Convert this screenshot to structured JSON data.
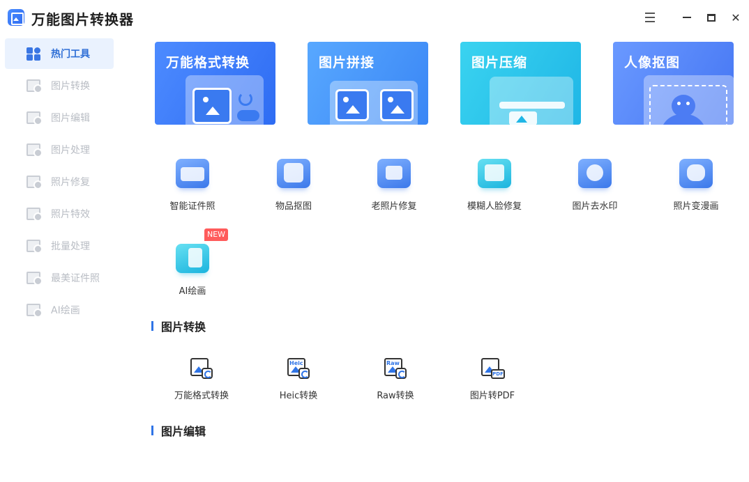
{
  "app": {
    "title": "万能图片转换器"
  },
  "sidebar": {
    "items": [
      {
        "label": "热门工具",
        "active": true
      },
      {
        "label": "图片转换"
      },
      {
        "label": "图片编辑"
      },
      {
        "label": "图片处理"
      },
      {
        "label": "照片修复"
      },
      {
        "label": "照片特效"
      },
      {
        "label": "批量处理"
      },
      {
        "label": "最美证件照"
      },
      {
        "label": "AI绘画"
      }
    ]
  },
  "banners": [
    {
      "title": "万能格式转换",
      "icon": "image-convert-icon"
    },
    {
      "title": "图片拼接",
      "icon": "image-stitch-icon"
    },
    {
      "title": "图片压缩",
      "icon": "image-compress-icon"
    },
    {
      "title": "人像抠图",
      "icon": "portrait-cutout-icon"
    }
  ],
  "tools": [
    {
      "label": "智能证件照",
      "icon": "id-photo-icon"
    },
    {
      "label": "物品抠图",
      "icon": "object-cutout-icon"
    },
    {
      "label": "老照片修复",
      "icon": "old-photo-repair-icon"
    },
    {
      "label": "模糊人脸修复",
      "icon": "face-restore-icon"
    },
    {
      "label": "图片去水印",
      "icon": "watermark-remove-icon"
    },
    {
      "label": "照片变漫画",
      "icon": "cartoon-icon"
    },
    {
      "label": "AI绘画",
      "icon": "ai-paint-icon",
      "badge": "NEW"
    }
  ],
  "sections": {
    "convert": {
      "title": "图片转换"
    },
    "edit": {
      "title": "图片编辑"
    }
  },
  "convert_tools": [
    {
      "label": "万能格式转换",
      "tag": ""
    },
    {
      "label": "Heic转换",
      "tag": "Heic"
    },
    {
      "label": "Raw转换",
      "tag": "Raw"
    },
    {
      "label": "图片转PDF",
      "tag": "PDF"
    }
  ],
  "colors": {
    "accent": "#2f74e6",
    "sidebar_active_bg": "#eaf2fe",
    "badge": "#ff5b5b"
  }
}
